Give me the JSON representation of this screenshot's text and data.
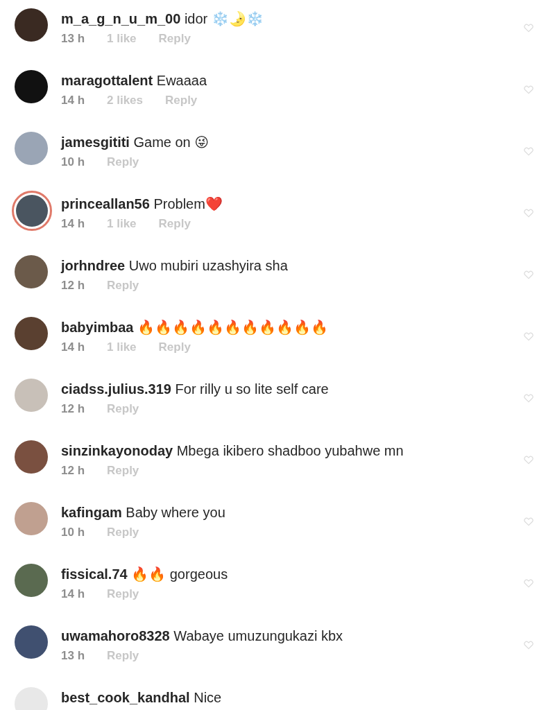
{
  "comments": [
    {
      "username": "m_a_g_n_u_m_00",
      "text": "idor ❄️🌛❄️",
      "time": "13 h",
      "likes": "1 like",
      "reply": "Reply",
      "story_ring": false
    },
    {
      "username": "maragottalent",
      "text": "Ewaaaa",
      "time": "14 h",
      "likes": "2 likes",
      "reply": "Reply",
      "story_ring": false
    },
    {
      "username": "jamesgititi",
      "text": "Game on 😜",
      "time": "10 h",
      "reply": "Reply",
      "story_ring": false
    },
    {
      "username": "princeallan56",
      "text": "Problem❤️",
      "time": "14 h",
      "likes": "1 like",
      "reply": "Reply",
      "story_ring": true
    },
    {
      "username": "jorhndree",
      "text": "Uwo mubiri uzashyira sha",
      "time": "12 h",
      "reply": "Reply",
      "story_ring": false
    },
    {
      "username": "babyimbaa",
      "text": "🔥🔥🔥🔥🔥🔥🔥🔥🔥🔥🔥",
      "time": "14 h",
      "likes": "1 like",
      "reply": "Reply",
      "story_ring": false
    },
    {
      "username": "ciadss.julius.319",
      "text": "For rilly u so lite self care",
      "time": "12 h",
      "reply": "Reply",
      "story_ring": false
    },
    {
      "username": "sinzinkayonoday",
      "text": "Mbega ikibero shadboo yubahwe mn",
      "time": "12 h",
      "reply": "Reply",
      "story_ring": false
    },
    {
      "username": "kafingam",
      "text": "Baby where you",
      "time": "10 h",
      "reply": "Reply",
      "story_ring": false
    },
    {
      "username": "fissical.74",
      "text": "🔥🔥 gorgeous",
      "time": "14 h",
      "reply": "Reply",
      "story_ring": false
    },
    {
      "username": "uwamahoro8328",
      "text": "Wabaye umuzungukazi kbx",
      "time": "13 h",
      "reply": "Reply",
      "story_ring": false
    },
    {
      "username": "best_cook_kandhal",
      "text": "Nice",
      "story_ring": false
    }
  ]
}
